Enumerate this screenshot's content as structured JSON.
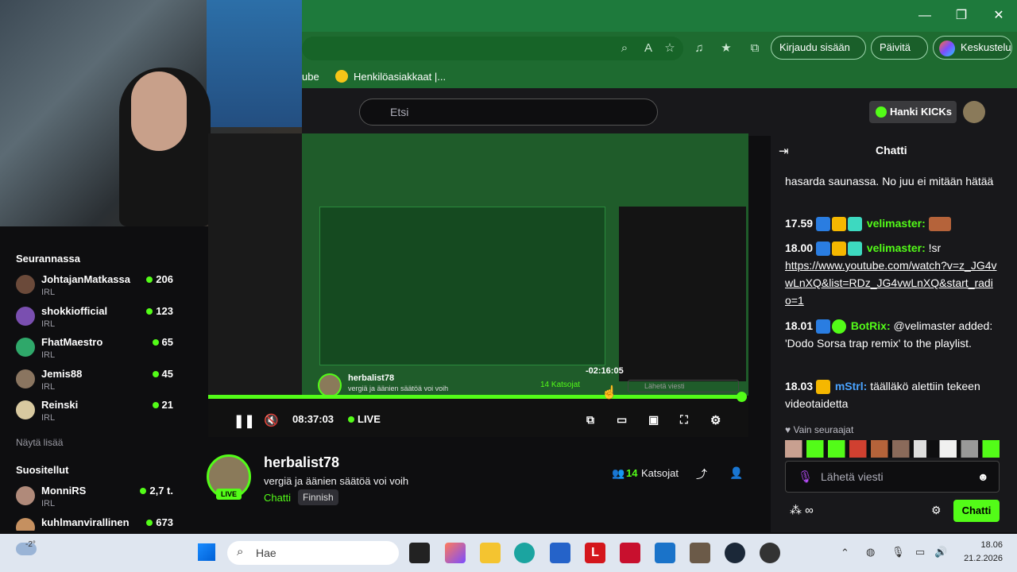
{
  "browser": {
    "favorite_partial": "ube",
    "favorite": "Henkilöasiakkaat |...",
    "login": "Kirjaudu sisään",
    "update": "Päivitä",
    "copilot": "Keskustelu"
  },
  "site": {
    "search_placeholder": "Etsi",
    "kicks": "Hanki KICKs"
  },
  "sidebar": {
    "following_title": "Seurannassa",
    "following": [
      {
        "name": "JohtajanMatkassa",
        "category": "IRL",
        "viewers": "206"
      },
      {
        "name": "shokkiofficial",
        "category": "IRL",
        "viewers": "123"
      },
      {
        "name": "FhatMaestro",
        "category": "IRL",
        "viewers": "65"
      },
      {
        "name": "Jemis88",
        "category": "IRL",
        "viewers": "45"
      },
      {
        "name": "Reinski",
        "category": "IRL",
        "viewers": "21"
      }
    ],
    "show_more": "Näytä lisää",
    "recommended_title": "Suositellut",
    "recommended": [
      {
        "name": "MonniRS",
        "category": "IRL",
        "viewers": "2,7 t."
      },
      {
        "name": "kuhlmanvirallinen",
        "category": "",
        "viewers": "673"
      }
    ]
  },
  "player": {
    "time": "08:37:03",
    "live": "LIVE",
    "remaining": "-02:16:05",
    "progress": 0.99,
    "inner_streamer": "herbalist78",
    "inner_title": "vergiä ja äänien säätöä voi voih",
    "inner_viewers": "14 Katsojat",
    "inner_chat_placeholder": "Lähetä viesti"
  },
  "stream": {
    "streamer": "herbalist78",
    "title": "vergiä ja äänien säätöä voi voih",
    "category": "Chatti",
    "tag": "Finnish",
    "live": "LIVE",
    "viewers": "14",
    "viewers_label": "Katsojat"
  },
  "chat": {
    "title": "Chatti",
    "messages": [
      {
        "text": "hasarda saunassa. No juu ei mitään hätää"
      },
      {
        "time": "17.59",
        "user": "velimaster",
        "text": ""
      },
      {
        "time": "18.00",
        "user": "velimaster",
        "text": "!sr",
        "link": "https://www.youtube.com/watch?v=z_JG4vwLnXQ&list=RDz_JG4vwLnXQ&start_radio=1"
      },
      {
        "time": "18.01",
        "user": "BotRix",
        "text": "@velimaster added: 'Dodo Sorsa trap remix' to the playlist."
      },
      {
        "time": "18.03",
        "user": "mStrl",
        "text": "täälläkö alettiin tekeen videotaidetta"
      }
    ],
    "followers_only": "Vain seuraajat",
    "input_placeholder": "Lähetä viesti",
    "send_button": "Chatti"
  },
  "taskbar": {
    "weather": "-2°",
    "search": "Hae",
    "time": "18.06",
    "date": "21.2.2026"
  },
  "colors": {
    "kick_green": "#53fc18",
    "edge_green": "#1e7a3c",
    "bg_dark": "#0e0e10",
    "panel": "#18181b"
  }
}
